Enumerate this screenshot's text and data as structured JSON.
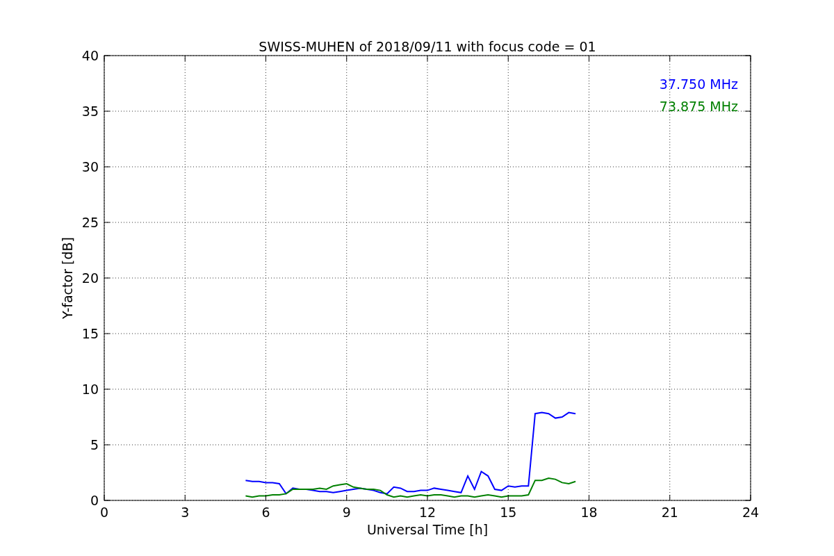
{
  "figure": {
    "chart_data": {
      "type": "line",
      "title": "SWISS-MUHEN of 2018/09/11 with focus code = 01",
      "xlabel": "Universal Time [h]",
      "ylabel": "Y-factor [dB]",
      "x": [
        5.25,
        5.5,
        5.75,
        6.0,
        6.25,
        6.5,
        6.75,
        7.0,
        7.25,
        7.5,
        7.75,
        8.0,
        8.25,
        8.5,
        8.75,
        9.0,
        9.25,
        9.5,
        9.75,
        10.0,
        10.25,
        10.5,
        10.75,
        11.0,
        11.25,
        11.5,
        11.75,
        12.0,
        12.25,
        12.5,
        12.75,
        13.0,
        13.25,
        13.5,
        13.75,
        14.0,
        14.25,
        14.5,
        14.75,
        15.0,
        15.25,
        15.5,
        15.75,
        16.0,
        16.25,
        16.5,
        16.75,
        17.0,
        17.25,
        17.5
      ],
      "series": [
        {
          "name": "37.750 MHz",
          "color": "#0000ff",
          "values": [
            1.8,
            1.7,
            1.7,
            1.6,
            1.6,
            1.5,
            0.6,
            1.1,
            1.0,
            1.0,
            0.9,
            0.8,
            0.8,
            0.7,
            0.8,
            0.9,
            1.0,
            1.1,
            1.0,
            0.9,
            0.7,
            0.6,
            1.2,
            1.1,
            0.8,
            0.8,
            0.9,
            0.9,
            1.1,
            1.0,
            0.9,
            0.8,
            0.7,
            2.2,
            1.0,
            2.6,
            2.2,
            1.0,
            0.9,
            1.3,
            1.2,
            1.3,
            1.3,
            7.8,
            7.9,
            7.8,
            7.4,
            7.5,
            7.9,
            7.8
          ]
        },
        {
          "name": "73.875 MHz",
          "color": "#008000",
          "values": [
            0.4,
            0.3,
            0.4,
            0.4,
            0.5,
            0.5,
            0.6,
            1.0,
            1.0,
            1.0,
            1.0,
            1.1,
            1.0,
            1.3,
            1.4,
            1.5,
            1.2,
            1.1,
            1.0,
            1.0,
            0.9,
            0.5,
            0.3,
            0.4,
            0.3,
            0.4,
            0.5,
            0.4,
            0.5,
            0.5,
            0.4,
            0.3,
            0.4,
            0.4,
            0.3,
            0.4,
            0.5,
            0.4,
            0.3,
            0.4,
            0.4,
            0.4,
            0.5,
            1.8,
            1.8,
            2.0,
            1.9,
            1.6,
            1.5,
            1.7
          ]
        }
      ],
      "xlim": [
        0,
        24
      ],
      "ylim": [
        0,
        40
      ],
      "xticks": [
        0,
        3,
        6,
        9,
        12,
        15,
        18,
        21,
        24
      ],
      "yticks": [
        0,
        5,
        10,
        15,
        20,
        25,
        30,
        35,
        40
      ],
      "grid": true
    }
  }
}
